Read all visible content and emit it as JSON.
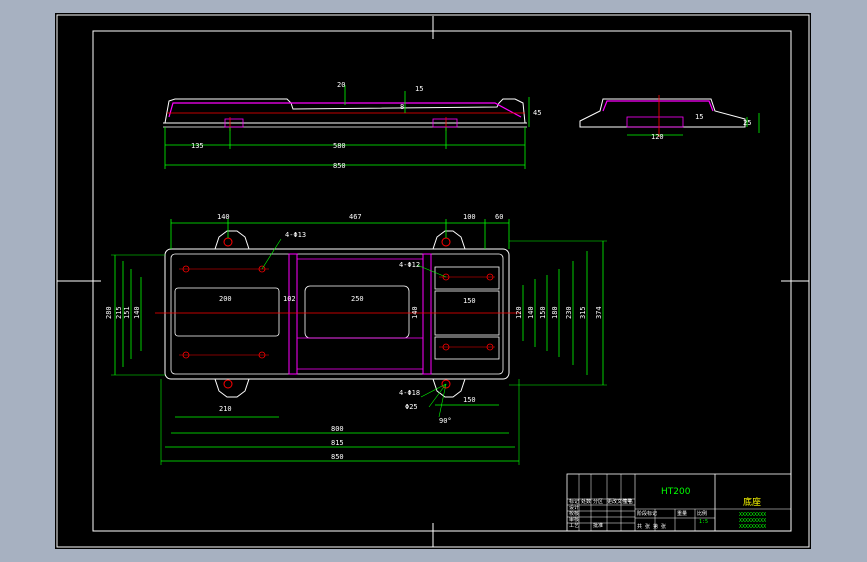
{
  "drawing": {
    "part_name": "底座",
    "model_code": "HT200",
    "front_view": {
      "dims": [
        "20",
        "15",
        "8",
        "45",
        "135",
        "580",
        "850"
      ]
    },
    "side_view": {
      "dims": [
        "120",
        "15",
        "25"
      ]
    },
    "top_view": {
      "dims_top": [
        "140",
        "467",
        "100",
        "60"
      ],
      "dims_left": [
        "280",
        "215",
        "151",
        "140"
      ],
      "dims_right": [
        "120",
        "140",
        "150",
        "180",
        "230",
        "315",
        "374"
      ],
      "dims_bottom": [
        "800",
        "815",
        "850"
      ],
      "inner_labels": [
        "200",
        "102",
        "250",
        "140",
        "150",
        "210",
        "150"
      ],
      "callouts": {
        "hole_a": "4-Φ13",
        "hole_b": "4-Φ12",
        "hole_c": "4-Φ18",
        "counterbore": "Φ25",
        "angle": "90°"
      }
    },
    "title_block": {
      "row_labels": [
        "标记",
        "处数",
        "分区",
        "更改文件号",
        "签名"
      ],
      "row_labels_2": [
        "设计",
        "校核",
        "审核",
        "工艺",
        "批准"
      ],
      "stage_labels": [
        "阶段标记",
        "重量",
        "比例"
      ],
      "scale": "1:5",
      "sheet_info": "共 张 第 张",
      "right_lines": [
        "XXXXXXXXX",
        "XXXXXXXXX",
        "XXXXXXXXX"
      ]
    }
  }
}
